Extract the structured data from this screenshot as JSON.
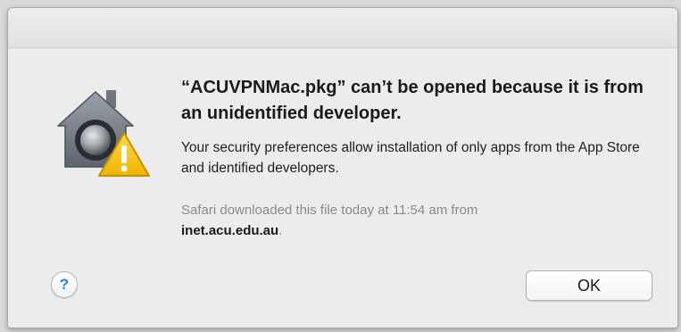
{
  "dialog": {
    "icon": "gatekeeper-house-lock-warning-icon",
    "headline": "“ACUVPNMac.pkg” can’t be opened because it is from an unidentified developer.",
    "message": "Your security preferences allow installation of only apps from the App Store and identified developers.",
    "download_note_prefix": "Safari downloaded this file today at 11:54 am from",
    "download_host": "inet.acu.edu.au",
    "download_note_suffix": ".",
    "help_label": "?",
    "ok_label": "OK"
  },
  "colors": {
    "dialog_background": "#ececec",
    "accent_blue": "#2d7fe0",
    "warning_yellow": "#f5c400",
    "secondary_text": "#8a8a8a"
  }
}
